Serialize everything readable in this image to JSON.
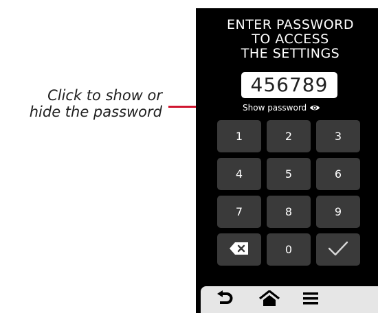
{
  "annotation": {
    "line1": "Click to show or",
    "line2": "hide the password",
    "color": "#d0152f"
  },
  "screen": {
    "title_lines": [
      "ENTER PASSWORD",
      "TO ACCESS",
      "THE SETTINGS"
    ],
    "password_value": "456789",
    "show_password_label": "Show password",
    "show_password_icon": "eye-icon"
  },
  "keypad": {
    "keys": [
      "1",
      "2",
      "3",
      "4",
      "5",
      "6",
      "7",
      "8",
      "9",
      "0"
    ],
    "backspace_icon": "backspace-icon",
    "confirm_icon": "checkmark-icon"
  },
  "nav": {
    "items": [
      "back-icon",
      "home-icon",
      "menu-icon"
    ]
  },
  "colors": {
    "screen_bg": "#000000",
    "key_bg": "#3a3a3a",
    "nav_bg": "#e6e6e6",
    "accent": "#d0152f"
  }
}
